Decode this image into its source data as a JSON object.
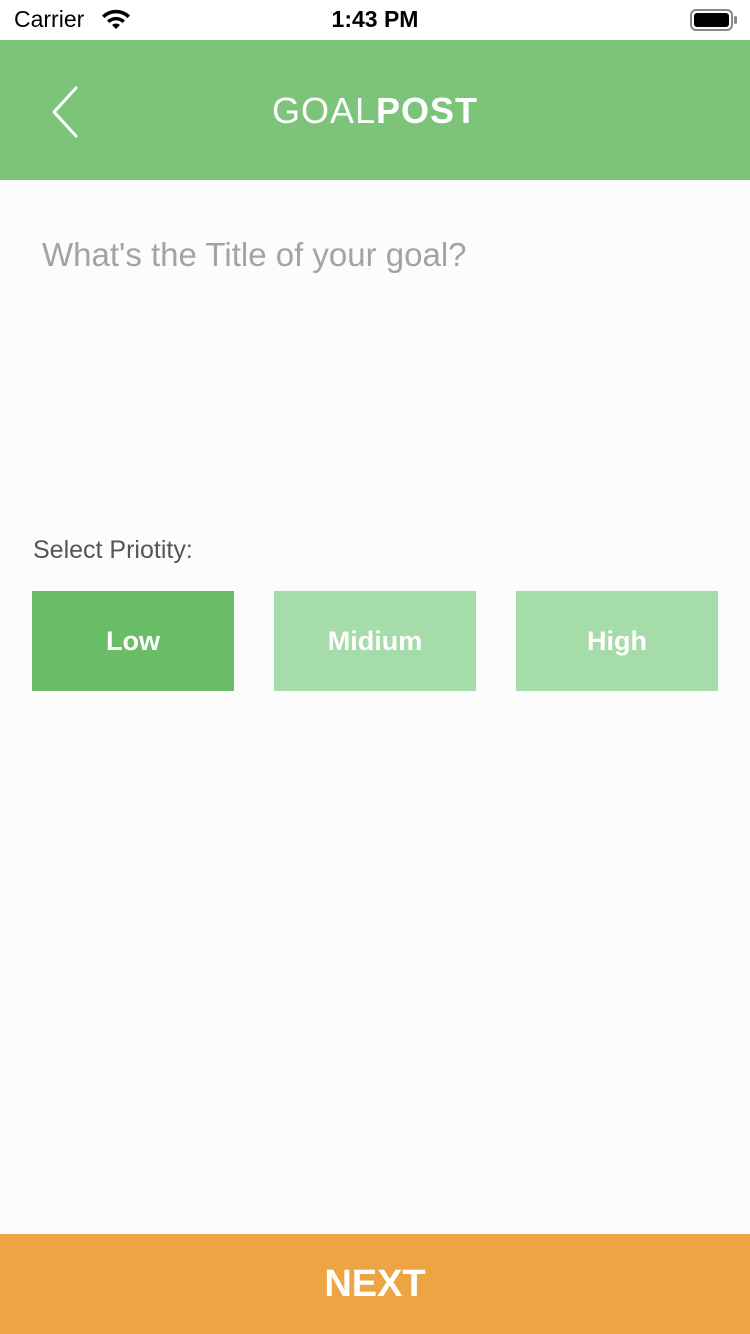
{
  "status_bar": {
    "carrier": "Carrier",
    "time": "1:43 PM"
  },
  "header": {
    "title_light": "GOAL",
    "title_bold": "POST",
    "back_icon": "chevron-left-icon"
  },
  "goal_input": {
    "placeholder": "What's the Title of your goal?",
    "value": ""
  },
  "priority": {
    "label": "Select Priotity:",
    "options": [
      {
        "label": "Low",
        "selected": true
      },
      {
        "label": "Midium",
        "selected": false
      },
      {
        "label": "High",
        "selected": false
      }
    ]
  },
  "footer": {
    "next_label": "NEXT"
  },
  "colors": {
    "header_green": "#7cc47a",
    "selected_green": "#69bd67",
    "unselected_green": "#a6dbaa",
    "next_orange": "#eca542"
  }
}
